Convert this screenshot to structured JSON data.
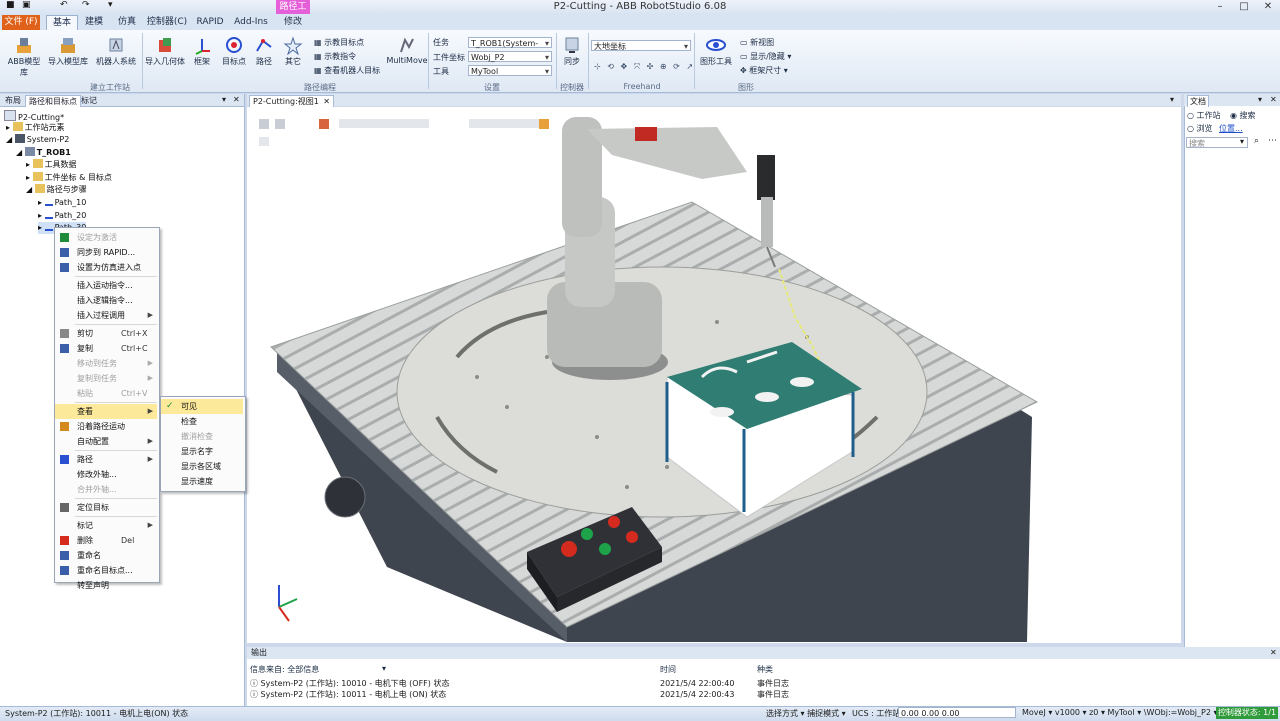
{
  "app": {
    "title": "P2-Cutting - ABB RobotStudio 6.08",
    "context_tab_title": "路径工具"
  },
  "tabs": {
    "file": "文件 (F)",
    "home": "基本",
    "modeling": "建模",
    "simulation": "仿真",
    "controller": "控制器(C)",
    "rapid": "RAPID",
    "addins": "Add-Ins",
    "modify": "修改"
  },
  "ribbon": {
    "build_station": {
      "abb_library": "ABB模型库",
      "import_library": "导入模型库",
      "robot_system": "机器人系统",
      "group_label": "建立工作站"
    },
    "path_programming": {
      "import_geometry": "导入几何体",
      "frame": "框架",
      "target": "目标点",
      "path": "路径",
      "other": "其它",
      "teach_target": "示教目标点",
      "teach_instruction": "示教指令",
      "view_robot_target": "查看机器人目标",
      "multimove": "MultiMove",
      "group_label": "路径编程"
    },
    "settings": {
      "task_label": "任务",
      "task_value": "T_ROB1(System-P2)",
      "wobj_label": "工件坐标",
      "wobj_value": "Wobj_P2",
      "tool_label": "工具",
      "tool_value": "MyTool",
      "group_label": "设置"
    },
    "controller": {
      "sync": "同步",
      "group_label": "控制器"
    },
    "freehand": {
      "coord_value": "大地坐标",
      "group_label": "Freehand"
    },
    "graphics": {
      "graphics_tools": "图形工具",
      "new_view": "新视图",
      "show_hide": "显示/隐藏",
      "frame_size": "框架尺寸",
      "group_label": "图形"
    }
  },
  "left_panel": {
    "tabs": [
      "布局",
      "路径和目标点",
      "标记"
    ],
    "tree": [
      "P2-Cutting*",
      "工作站元素",
      "System-P2",
      "T_ROB1",
      "工具数据",
      "工件坐标 & 目标点",
      "路径与步骤",
      "Path_10",
      "Path_20",
      "Path_30"
    ]
  },
  "context_menu": {
    "items": [
      {
        "label": "设定为激活",
        "enabled": false
      },
      {
        "label": "同步到 RAPID...",
        "enabled": true
      },
      {
        "label": "设置为仿真进入点",
        "enabled": true
      },
      {
        "label": "插入运动指令...",
        "enabled": true
      },
      {
        "label": "插入逻辑指令...",
        "enabled": true
      },
      {
        "label": "插入过程调用",
        "enabled": true
      },
      {
        "label": "剪切",
        "shortcut": "Ctrl+X",
        "enabled": true
      },
      {
        "label": "复制",
        "shortcut": "Ctrl+C",
        "enabled": true
      },
      {
        "label": "移动到任务",
        "enabled": false
      },
      {
        "label": "复制到任务",
        "enabled": false
      },
      {
        "label": "粘贴",
        "shortcut": "Ctrl+V",
        "enabled": false
      },
      {
        "label": "查看",
        "enabled": true
      },
      {
        "label": "沿着路径运动",
        "enabled": true
      },
      {
        "label": "自动配置",
        "enabled": true
      },
      {
        "label": "路径",
        "enabled": true
      },
      {
        "label": "修改外轴...",
        "enabled": true
      },
      {
        "label": "合并外轴...",
        "enabled": false
      },
      {
        "label": "定位目标",
        "enabled": true
      },
      {
        "label": "标记",
        "enabled": true
      },
      {
        "label": "删除",
        "shortcut": "Del",
        "enabled": true
      },
      {
        "label": "重命名",
        "enabled": true
      },
      {
        "label": "重命名目标点...",
        "enabled": true
      },
      {
        "label": "转至声明",
        "enabled": true
      }
    ],
    "submenu": [
      "可见",
      "检查",
      "撤消检查",
      "显示名字",
      "显示各区域",
      "显示速度"
    ]
  },
  "viewport": {
    "tab_label": "P2-Cutting:视图1"
  },
  "right_panel": {
    "title": "文档",
    "radio_station": "工作站",
    "radio_search": "搜索",
    "radio_browse": "浏览",
    "location_link": "位置...",
    "search_placeholder": "搜索"
  },
  "output": {
    "title": "输出",
    "filter_label": "信息来自: 全部信息",
    "col_time": "时间",
    "col_type": "种类",
    "rows": [
      {
        "msg": "System-P2 (工作站): 10010 - 电机下电 (OFF) 状态",
        "time": "2021/5/4 22:00:40",
        "type": "事件日志"
      },
      {
        "msg": "System-P2 (工作站): 10011 - 电机上电 (ON) 状态",
        "time": "2021/5/4 22:00:43",
        "type": "事件日志"
      }
    ]
  },
  "status": {
    "left": "System-P2 (工作站): 10011 - 电机上电(ON) 状态",
    "select_mode": "选择方式 ▾ 捕捉模式 ▾",
    "ucs": "UCS : 工作站",
    "coords": "0.00 0.00 0.00",
    "jog_params": "MoveJ ▾ v1000 ▾ z0 ▾ MyTool ▾ \\WObj:=Wobj_P2 ▾",
    "controller_status": "控制器状态: 1/1"
  },
  "colors": {
    "file_tab": "#e0621a",
    "context_tab": "#e45fd8",
    "robot_red_stop": "#d52b1e",
    "green_button": "#1ea34b",
    "status_green": "#2f9b3a"
  }
}
